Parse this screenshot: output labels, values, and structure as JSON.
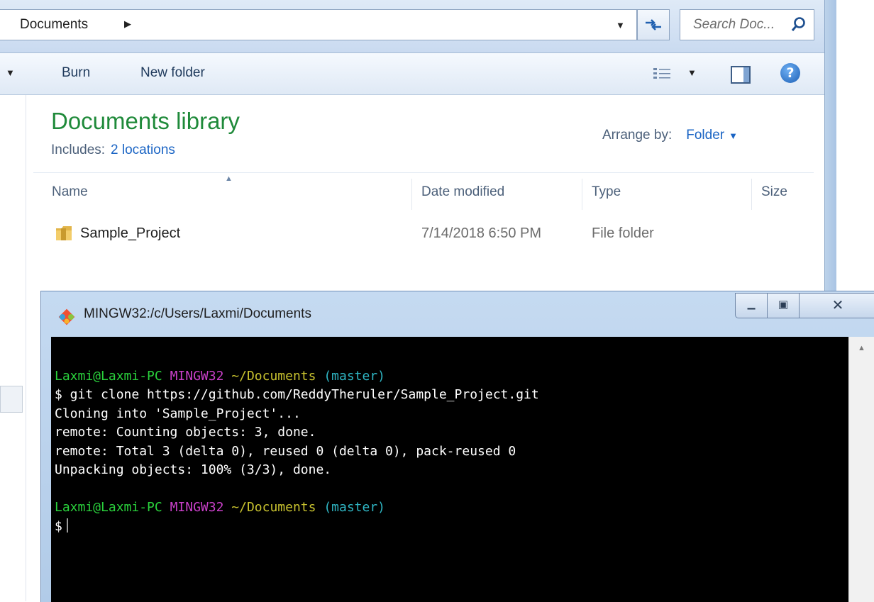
{
  "explorer": {
    "address": {
      "breadcrumb": "Documents",
      "search_placeholder": "Search Doc..."
    },
    "toolbar": {
      "burn_label": "Burn",
      "new_folder_label": "New folder"
    },
    "library": {
      "title": "Documents library",
      "includes_label": "Includes:",
      "includes_link": "2 locations",
      "arrange_label": "Arrange by:",
      "arrange_value": "Folder"
    },
    "columns": {
      "name": "Name",
      "date": "Date modified",
      "type": "Type",
      "size": "Size"
    },
    "files": [
      {
        "name": "Sample_Project",
        "date": "7/14/2018 6:50 PM",
        "type": "File folder"
      }
    ]
  },
  "terminal": {
    "title": "MINGW32:/c/Users/Laxmi/Documents",
    "prompt_user": "Laxmi@Laxmi-PC",
    "prompt_env": "MINGW32",
    "prompt_path": "~/Documents",
    "prompt_branch": "(master)",
    "command": "$ git clone https://github.com/ReddyTheruler/Sample_Project.git",
    "output": [
      "Cloning into 'Sample_Project'...",
      "remote: Counting objects: 3, done.",
      "remote: Total 3 (delta 0), reused 0 (delta 0), pack-reused 0",
      "Unpacking objects: 100% (3/3), done."
    ],
    "prompt_symbol": "$"
  },
  "icons": {
    "refresh": "refresh-icon",
    "search": "search-icon",
    "folder": "folder-icon",
    "help": "help-icon",
    "git": "git-icon"
  },
  "colors": {
    "library_title": "#1f8a3a",
    "link": "#1a64c4",
    "prompt_user": "#2ad13c",
    "prompt_env": "#c940c9",
    "prompt_path": "#c8c22f",
    "prompt_branch": "#2fb6c4"
  }
}
